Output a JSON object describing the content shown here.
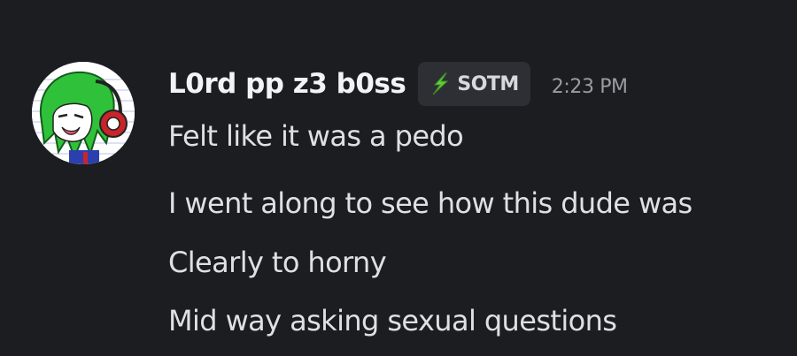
{
  "message": {
    "author": "L0rd pp z3 b0ss",
    "role_tag": {
      "icon": "lightning-bolt-icon",
      "label": "SOTM",
      "icon_color": "#5fcf3a"
    },
    "timestamp": "2:23 PM",
    "avatar": {
      "icon": "avatar-green-hair-headphones"
    },
    "lines": [
      "Felt like it was a pedo",
      "I went along to see how this dude was",
      "Clearly to horny",
      "Mid way asking sexual questions"
    ]
  },
  "colors": {
    "background": "#1c1d21",
    "username": "#f2f3f5",
    "text": "#dfe0e4",
    "timestamp": "#9a9ca4",
    "role_tag_bg": "#2e2f35"
  }
}
